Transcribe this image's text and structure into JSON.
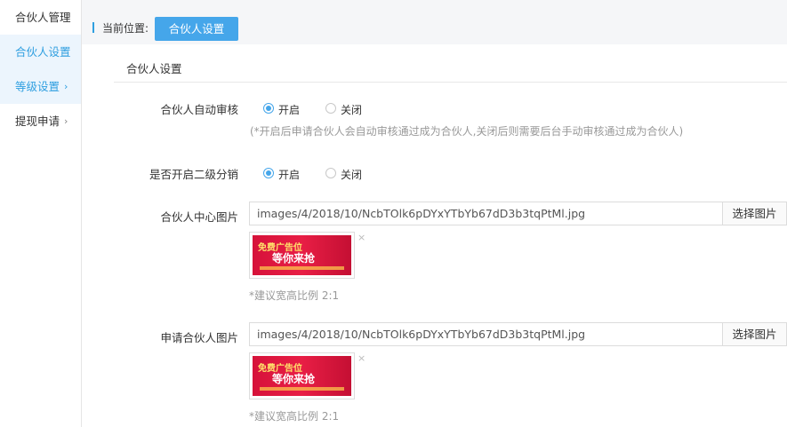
{
  "sidebar": {
    "items": [
      {
        "label": "合伙人管理",
        "chevron": ""
      },
      {
        "label": "合伙人设置",
        "chevron": ""
      },
      {
        "label": "等级设置",
        "chevron": "›"
      },
      {
        "label": "提现申请",
        "chevron": "›"
      }
    ]
  },
  "breadcrumb": {
    "prefix": "当前位置:",
    "current": "合伙人设置"
  },
  "section": {
    "title": "合伙人设置"
  },
  "form": {
    "auto_review": {
      "label": "合伙人自动审核",
      "option_on": "开启",
      "option_off": "关闭",
      "hint": "(*开启后申请合伙人会自动审核通过成为合伙人,关闭后则需要后台手动审核通过成为合伙人)"
    },
    "second_level": {
      "label": "是否开启二级分销",
      "option_on": "开启",
      "option_off": "关闭"
    },
    "center_image": {
      "label": "合伙人中心图片",
      "value": "images/4/2018/10/NcbTOlk6pDYxYTbYb67dD3b3tqPtMl.jpg",
      "button": "选择图片",
      "banner_line1": "免费广告位",
      "banner_line2": "等你来抢",
      "remove": "×",
      "hint": "*建议宽高比例 2:1"
    },
    "apply_image": {
      "label": "申请合伙人图片",
      "value": "images/4/2018/10/NcbTOlk6pDYxYTbYb67dD3b3tqPtMl.jpg",
      "button": "选择图片",
      "banner_line1": "免费广告位",
      "banner_line2": "等你来抢",
      "remove": "×",
      "hint": "*建议宽高比例 2:1"
    }
  },
  "colors": {
    "accent": "#45a6ea",
    "active_text": "#2f9fe0",
    "banner": "#d6123a"
  }
}
